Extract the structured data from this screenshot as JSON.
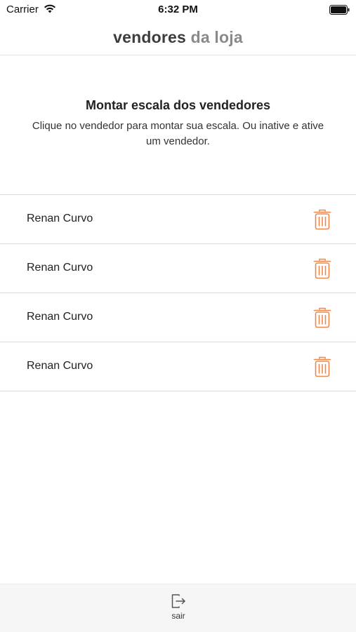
{
  "status_bar": {
    "carrier": "Carrier",
    "time": "6:32 PM"
  },
  "nav": {
    "title_part1": "vendores",
    "title_part2": "da loja"
  },
  "intro": {
    "title": "Montar escala dos vendedores",
    "text": "Clique no vendedor para montar sua escala. Ou inative e ative um vendedor."
  },
  "sellers": [
    {
      "name": "Renan Curvo",
      "action_icon": "trash-icon"
    },
    {
      "name": "Renan Curvo",
      "action_icon": "trash-icon"
    },
    {
      "name": "Renan Curvo",
      "action_icon": "trash-icon"
    },
    {
      "name": "Renan Curvo",
      "action_icon": "trash-icon"
    }
  ],
  "tab_bar": {
    "logout_label": "sair",
    "logout_icon": "logout-icon"
  },
  "colors": {
    "accent": "#f0874a",
    "divider": "#dcdcdc",
    "tab_bar_bg": "#f6f6f6"
  }
}
